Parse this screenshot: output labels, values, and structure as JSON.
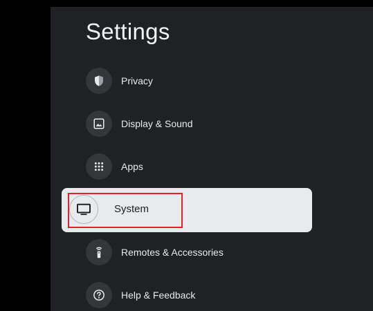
{
  "title": "Settings",
  "items": [
    {
      "label": "Privacy",
      "icon": "shield-icon"
    },
    {
      "label": "Display & Sound",
      "icon": "image-icon"
    },
    {
      "label": "Apps",
      "icon": "grid-icon"
    },
    {
      "label": "System",
      "icon": "tv-icon",
      "selected": true
    },
    {
      "label": "Remotes & Accessories",
      "icon": "remote-icon"
    },
    {
      "label": "Help & Feedback",
      "icon": "help-icon"
    }
  ],
  "colors": {
    "background": "#000000",
    "panel": "#202124",
    "selected_background": "#e8eaed",
    "highlight_border": "#e4202f"
  }
}
